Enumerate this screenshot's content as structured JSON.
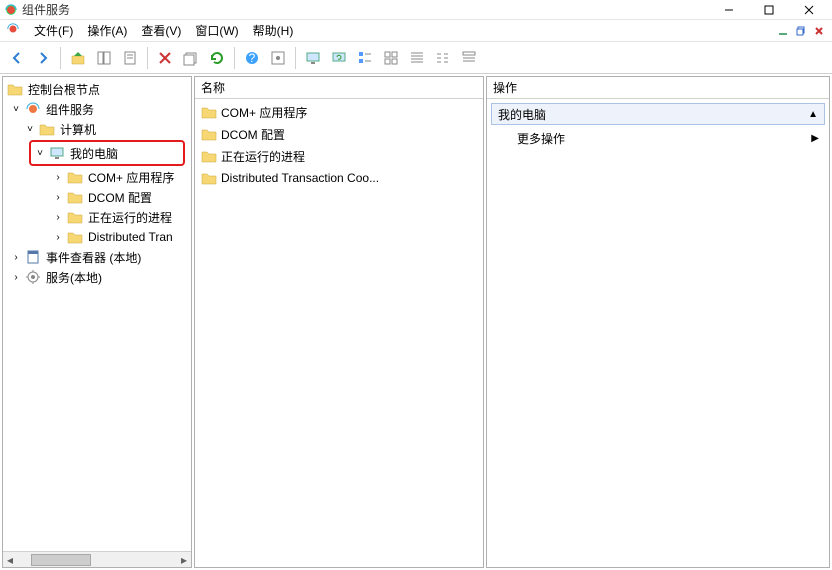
{
  "window": {
    "title": "组件服务"
  },
  "menus": {
    "file": "文件(F)",
    "action": "操作(A)",
    "view": "查看(V)",
    "window": "窗口(W)",
    "help": "帮助(H)"
  },
  "tree": {
    "root": "控制台根节点",
    "component_services": "组件服务",
    "computers": "计算机",
    "my_computer": "我的电脑",
    "com_plus": "COM+ 应用程序",
    "dcom_config": "DCOM 配置",
    "running_processes": "正在运行的进程",
    "dtc": "Distributed Tran",
    "event_viewer": "事件查看器 (本地)",
    "services": "服务(本地)"
  },
  "list": {
    "header": "名称",
    "items": [
      "COM+ 应用程序",
      "DCOM 配置",
      "正在运行的进程",
      "Distributed Transaction Coo..."
    ]
  },
  "actions": {
    "header": "操作",
    "subject": "我的电脑",
    "more": "更多操作"
  }
}
